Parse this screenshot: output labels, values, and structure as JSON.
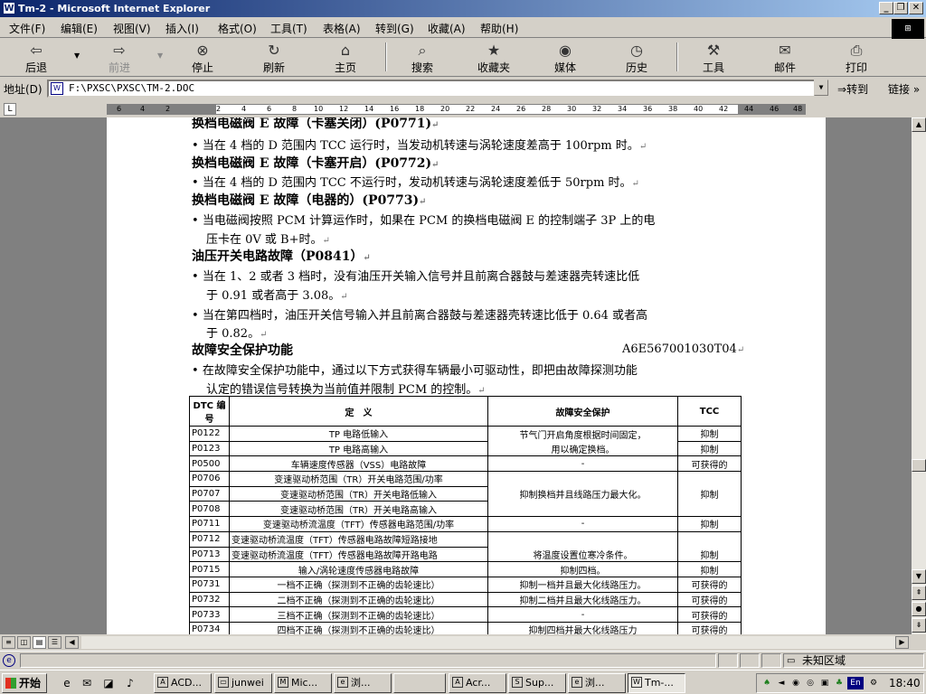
{
  "window": {
    "title": "Tm-2 - Microsoft Internet Explorer",
    "app_icon": "ie-document-icon"
  },
  "menu": [
    "文件(F)",
    "编辑(E)",
    "视图(V)",
    "插入(I)",
    "格式(O)",
    "工具(T)",
    "表格(A)",
    "转到(G)",
    "收藏(A)",
    "帮助(H)"
  ],
  "toolbar": {
    "back": "后退",
    "forward": "前进",
    "stop": "停止",
    "refresh": "刷新",
    "home": "主页",
    "search": "搜索",
    "favorites": "收藏夹",
    "media": "媒体",
    "history": "历史",
    "tools": "工具",
    "mail": "邮件",
    "print": "打印"
  },
  "address": {
    "label": "地址(D)",
    "value": "F:\\PXSC\\PXSC\\TM-2.DOC",
    "go": "转到",
    "links": "链接"
  },
  "ruler": {
    "ticks": [
      "6",
      "4",
      "2",
      "2",
      "4",
      "6",
      "8",
      "10",
      "12",
      "14",
      "16",
      "18",
      "20",
      "22",
      "24",
      "26",
      "28",
      "30",
      "32",
      "34",
      "36",
      "38",
      "40",
      "42",
      "44",
      "46",
      "48"
    ]
  },
  "doc": {
    "h1": "换档电磁阀 E 故障（卡塞关闭）(P0771)",
    "b1": "当在 4 档的 D 范围内 TCC 运行时，当发动机转速与涡轮速度差高于 100rpm 时。",
    "h2": "换档电磁阀 E 故障（卡塞开启）(P0772)",
    "b2": "当在 4 档的 D 范围内 TCC 不运行时，发动机转速与涡轮速度差低于 50rpm 时。",
    "h3": "换档电磁阀 E 故障（电器的）(P0773)",
    "b3a": "当电磁阀按照 PCM 计算运作时，如果在 PCM 的换档电磁阀 E 的控制端子 3P 上的电",
    "b3b": "压卡在 0V 或 B+时。",
    "h4": "油压开关电路故障（P0841）",
    "b4a": "当在 1、2 或者 3 档时，没有油压开关输入信号并且前离合器鼓与差速器壳转速比低",
    "b4b": "于 0.91 或者高于 3.08。",
    "b5a": "当在第四档时，油压开关信号输入并且前离合器鼓与差速器壳转速比低于 0.64 或者高",
    "b5b": "于 0.82。",
    "h5": "故障安全保护功能",
    "section_id": "A6E567001030T04",
    "b6a": "在故障安全保护功能中，通过以下方式获得车辆最小可驱动性，即把由故障探测功能",
    "b6b": "认定的错误信号转换为当前值并限制 PCM 的控制。"
  },
  "table": {
    "headers": {
      "dtc": "DTC 编号",
      "def": "定　义",
      "fs": "故障安全保护",
      "tcc": "TCC"
    },
    "rows": [
      {
        "code": "P0122",
        "def": "TP 电路低输入",
        "fs": "节气门开启角度根据时间固定，",
        "tcc": "抑制"
      },
      {
        "code": "P0123",
        "def": "TP 电路高输入",
        "fs": "用以确定换档。",
        "tcc": "抑制"
      },
      {
        "code": "P0500",
        "def": "车辆速度传感器（VSS）电路故障",
        "fs": "-",
        "tcc": "可获得的"
      },
      {
        "code": "P0706",
        "def": "变速驱动桥范围（TR）开关电路范围/功率",
        "fs": "",
        "tcc": ""
      },
      {
        "code": "P0707",
        "def": "变速驱动桥范围（TR）开关电路低输入",
        "fs": "抑制换档并且线路压力最大化。",
        "tcc": "抑制"
      },
      {
        "code": "P0708",
        "def": "变速驱动桥范围（TR）开关电路高输入",
        "fs": "",
        "tcc": ""
      },
      {
        "code": "P0711",
        "def": "变速驱动桥流温度（TFT）传感器电路范围/功率",
        "fs": "-",
        "tcc": "抑制"
      },
      {
        "code": "P0712",
        "def": "变速驱动桥流温度（TFT）传感器电路故障短路接地",
        "fs": "",
        "tcc": ""
      },
      {
        "code": "P0713",
        "def": "变速驱动桥流温度（TFT）传感器电路故障开路电路",
        "fs": "将温度设置位寒冷条件。",
        "tcc": "抑制"
      },
      {
        "code": "P0715",
        "def": "输入/涡轮速度传感器电路故障",
        "fs": "抑制四档。",
        "tcc": "抑制"
      },
      {
        "code": "P0731",
        "def": "一档不正确（探测到不正确的齿轮速比）",
        "fs": "抑制一档并且最大化线路压力。",
        "tcc": "可获得的"
      },
      {
        "code": "P0732",
        "def": "二档不正确（探测到不正确的齿轮速比）",
        "fs": "抑制二档并且最大化线路压力。",
        "tcc": "可获得的"
      },
      {
        "code": "P0733",
        "def": "三档不正确（探测到不正确的齿轮速比）",
        "fs": "-",
        "tcc": "可获得的"
      },
      {
        "code": "P0734",
        "def": "四档不正确（探测到不正确的齿轮速比）",
        "fs": "抑制四档并最大化线路压力",
        "tcc": "可获得的"
      }
    ]
  },
  "status": {
    "zone": "未知区域"
  },
  "taskbar": {
    "start": "开始",
    "tasks": [
      "ACD...",
      "junwei",
      "Mic...",
      "浏...",
      "",
      "Acr...",
      "Sup...",
      "浏...",
      "Tm-..."
    ],
    "clock": "18:40",
    "lang": "En"
  }
}
